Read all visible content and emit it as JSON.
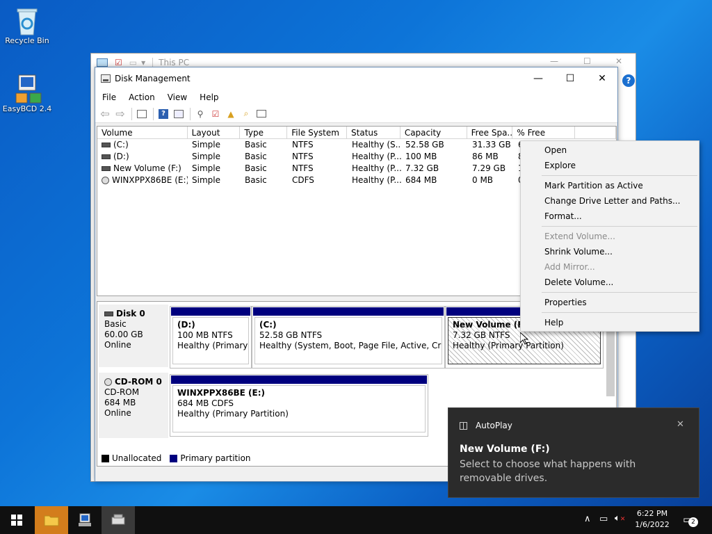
{
  "desktop": {
    "icons": [
      {
        "label": "Recycle Bin"
      },
      {
        "label": "EasyBCD 2.4"
      }
    ]
  },
  "explorer": {
    "title": "This PC"
  },
  "window": {
    "title": "Disk Management",
    "menu": [
      "File",
      "Action",
      "View",
      "Help"
    ]
  },
  "list": {
    "headers": [
      "Volume",
      "Layout",
      "Type",
      "File System",
      "Status",
      "Capacity",
      "Free Spa...",
      "% Free",
      ""
    ],
    "rows": [
      {
        "volume": "(C:)",
        "layout": "Simple",
        "type": "Basic",
        "fs": "NTFS",
        "status": "Healthy (S...",
        "capacity": "52.58 GB",
        "free": "31.33 GB",
        "pct": "6"
      },
      {
        "volume": "(D:)",
        "layout": "Simple",
        "type": "Basic",
        "fs": "NTFS",
        "status": "Healthy (P...",
        "capacity": "100 MB",
        "free": "86 MB",
        "pct": "8"
      },
      {
        "volume": "New Volume (F:)",
        "layout": "Simple",
        "type": "Basic",
        "fs": "NTFS",
        "status": "Healthy (P...",
        "capacity": "7.32 GB",
        "free": "7.29 GB",
        "pct": "1"
      },
      {
        "volume": "WINXPPX86BE (E:)",
        "layout": "Simple",
        "type": "Basic",
        "fs": "CDFS",
        "status": "Healthy (P...",
        "capacity": "684 MB",
        "free": "0 MB",
        "pct": "0"
      }
    ]
  },
  "disks": {
    "disk0": {
      "name": "Disk 0",
      "type": "Basic",
      "size": "60.00 GB",
      "state": "Online",
      "parts": [
        {
          "name": "(D:)",
          "size": "100 MB NTFS",
          "status": "Healthy (Primary Pa"
        },
        {
          "name": "(C:)",
          "size": "52.58 GB NTFS",
          "status": "Healthy (System, Boot, Page File, Active, Crash Du"
        },
        {
          "name": "New Volume  (F:)",
          "size": "7.32 GB NTFS",
          "status": "Healthy (Primary Partition)"
        }
      ]
    },
    "cdrom0": {
      "name": "CD-ROM 0",
      "type": "CD-ROM",
      "size": "684 MB",
      "state": "Online",
      "parts": [
        {
          "name": "WINXPPX86BE  (E:)",
          "size": "684 MB CDFS",
          "status": "Healthy (Primary Partition)"
        }
      ]
    }
  },
  "legend": {
    "unallocated": "Unallocated",
    "primary": "Primary partition"
  },
  "context_menu": {
    "open": "Open",
    "explore": "Explore",
    "mark_active": "Mark Partition as Active",
    "change_letter": "Change Drive Letter and Paths...",
    "format": "Format...",
    "extend": "Extend Volume...",
    "shrink": "Shrink Volume...",
    "add_mirror": "Add Mirror...",
    "delete": "Delete Volume...",
    "properties": "Properties",
    "help": "Help"
  },
  "toast": {
    "app": "AutoPlay",
    "title": "New Volume (F:)",
    "message": "Select to choose what happens with removable drives."
  },
  "taskbar": {
    "time": "6:22 PM",
    "date": "1/6/2022",
    "notifications": "2"
  },
  "colors": {
    "primary_partition": "#00007e",
    "desktop": "#0d74d8",
    "toast_bg": "#2b2b2b"
  }
}
